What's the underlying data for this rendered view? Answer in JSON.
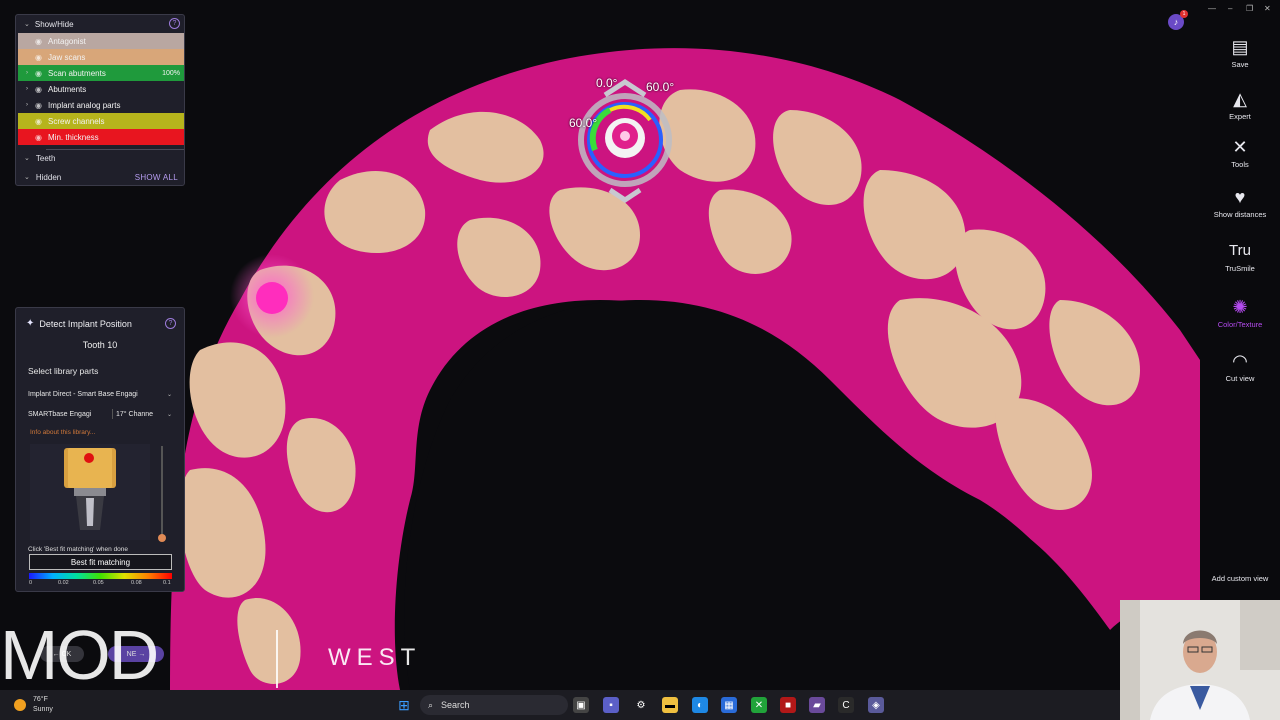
{
  "show_hide": {
    "title": "Show/Hide",
    "rows": [
      {
        "label": "Antagonist",
        "color": "#b9a7a1",
        "toggle": ""
      },
      {
        "label": "Jaw scans",
        "color": "#d8a679",
        "toggle": ""
      },
      {
        "label": "Scan abutments",
        "color": "#1f9a3c",
        "toggle": "›",
        "pct": "100%"
      },
      {
        "label": "Abutments",
        "color": "#1f1f2a",
        "toggle": "›"
      },
      {
        "label": "Implant analog parts",
        "color": "#1f1f2a",
        "toggle": "›"
      },
      {
        "label": "Screw channels",
        "color": "#b6b41c",
        "toggle": ""
      },
      {
        "label": "Min. thickness",
        "color": "#e8151f",
        "toggle": ""
      }
    ],
    "teeth_label": "Teeth",
    "hidden_label": "Hidden",
    "show_all": "SHOW ALL"
  },
  "detect": {
    "title": "Detect Implant Position",
    "tooth": "Tooth 10",
    "select_label": "Select library parts",
    "library": "Implant Direct - Smart Base Engagi",
    "part_left": "SMARTbase Engagi",
    "part_right": "17° Channe",
    "info_link": "Info about this library...",
    "hint": "Click 'Best fit matching' when done",
    "best_fit": "Best fit matching",
    "scale_ticks": [
      "0",
      "0.02",
      "0.05",
      "0.08",
      "0.1"
    ]
  },
  "angles": {
    "top": "0.0°",
    "right": "60.0°",
    "left": "60.0°"
  },
  "toolbar": {
    "items": [
      {
        "label": "Save",
        "icon": "save-icon",
        "glyph": "🖫"
      },
      {
        "label": "Expert",
        "icon": "graduation-cap-icon",
        "glyph": "🎓"
      },
      {
        "label": "Tools",
        "icon": "tools-icon",
        "glyph": "⚒"
      },
      {
        "label": "Show distances",
        "icon": "tooth-distance-icon",
        "glyph": "⛉"
      },
      {
        "label": "TruSmile",
        "icon": "trusmile-icon",
        "glyph": "Tru"
      },
      {
        "label": "Color/Texture",
        "icon": "palette-icon",
        "glyph": "🎨"
      },
      {
        "label": "Cut view",
        "icon": "cut-view-icon",
        "glyph": "⛉"
      }
    ],
    "add_custom_view": "Add custom view"
  },
  "notification_count": "1",
  "watermark": {
    "mod": "MOD",
    "west": "WEST",
    "back": "CK",
    "next": "NE"
  },
  "taskbar": {
    "temp": "76°F",
    "condition": "Sunny",
    "search": "Search"
  }
}
